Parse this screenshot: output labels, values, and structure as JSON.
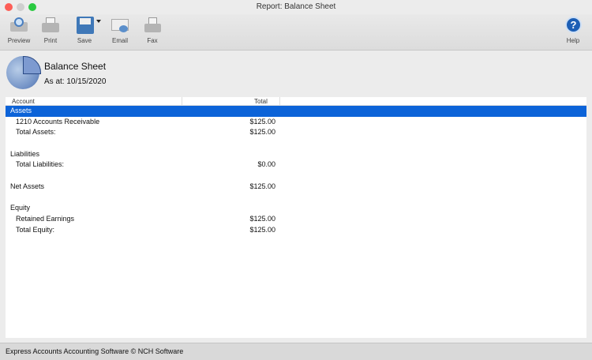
{
  "window": {
    "title": "Report: Balance Sheet"
  },
  "toolbar": {
    "preview": "Preview",
    "print": "Print",
    "save": "Save",
    "email": "Email",
    "fax": "Fax",
    "help": "Help"
  },
  "report": {
    "title": "Balance Sheet",
    "as_at": "As at: 10/15/2020"
  },
  "table": {
    "columns": [
      "Account",
      "Total"
    ],
    "rows": [
      {
        "account": "Assets",
        "total": "",
        "type": "section",
        "selected": true
      },
      {
        "account": "1210 Accounts Receivable",
        "total": "$125.00",
        "indent": true
      },
      {
        "account": "Total Assets:",
        "total": "$125.00",
        "indent": true
      },
      {
        "account": "",
        "total": ""
      },
      {
        "account": "Liabilities",
        "total": ""
      },
      {
        "account": "Total Liabilities:",
        "total": "$0.00",
        "indent": true
      },
      {
        "account": "",
        "total": ""
      },
      {
        "account": "Net Assets",
        "total": "$125.00"
      },
      {
        "account": "",
        "total": ""
      },
      {
        "account": "Equity",
        "total": ""
      },
      {
        "account": "Retained Earnings",
        "total": "$125.00",
        "indent": true
      },
      {
        "account": "Total Equity:",
        "total": "$125.00",
        "indent": true
      }
    ]
  },
  "footer": {
    "text": "Express Accounts Accounting Software © NCH Software"
  },
  "colors": {
    "selection": "#0c63d8"
  }
}
